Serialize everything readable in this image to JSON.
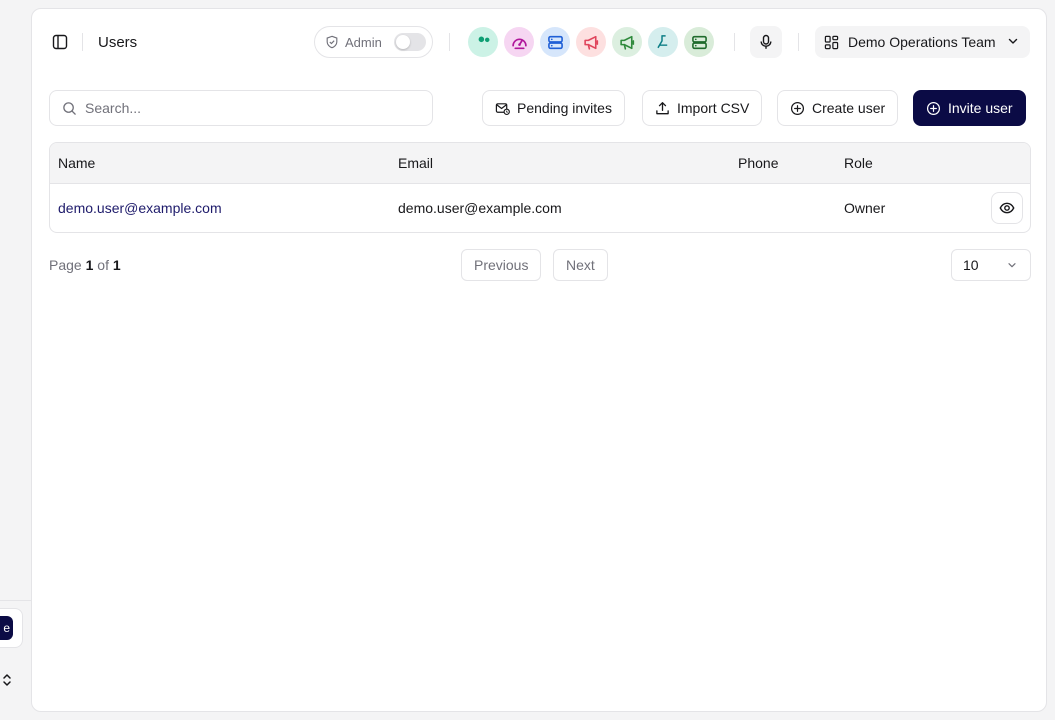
{
  "header": {
    "title": "Users",
    "admin_label": "Admin",
    "admin_enabled": false,
    "team_name": "Demo Operations Team",
    "app_icons": [
      {
        "name": "users-app-icon",
        "bg": "#ccf2e6",
        "fg": "#0f9f74"
      },
      {
        "name": "gauge-app-icon",
        "bg": "#f6d6f2",
        "fg": "#b0169a"
      },
      {
        "name": "server-app-icon",
        "bg": "#d6e6fb",
        "fg": "#1f5fd6"
      },
      {
        "name": "megaphone-red-app-icon",
        "bg": "#fde0e0",
        "fg": "#e0455c"
      },
      {
        "name": "megaphone-green-app-icon",
        "bg": "#dcefe0",
        "fg": "#2f8a3c"
      },
      {
        "name": "flask-app-icon",
        "bg": "#d5eeee",
        "fg": "#0d7f86"
      },
      {
        "name": "server-green-app-icon",
        "bg": "#d9ecd9",
        "fg": "#1f6b2c"
      }
    ]
  },
  "toolbar": {
    "search_placeholder": "Search...",
    "pending_invites": "Pending invites",
    "import_csv": "Import CSV",
    "create_user": "Create user",
    "invite_user": "Invite user"
  },
  "table": {
    "columns": [
      "Name",
      "Email",
      "Phone",
      "Role"
    ],
    "rows": [
      {
        "name": "demo.user@example.com",
        "email": "demo.user@example.com",
        "phone": "",
        "role": "Owner"
      }
    ]
  },
  "pagination": {
    "page_label": "Page",
    "current": "1",
    "of_label": "of",
    "total": "1",
    "previous": "Previous",
    "next": "Next",
    "page_size": "10"
  },
  "sidebar_remnant": {
    "pill_text": "e"
  },
  "colors": {
    "primary": "#0b0b45",
    "link": "#1e1b6b",
    "border": "#e4e4e7"
  }
}
